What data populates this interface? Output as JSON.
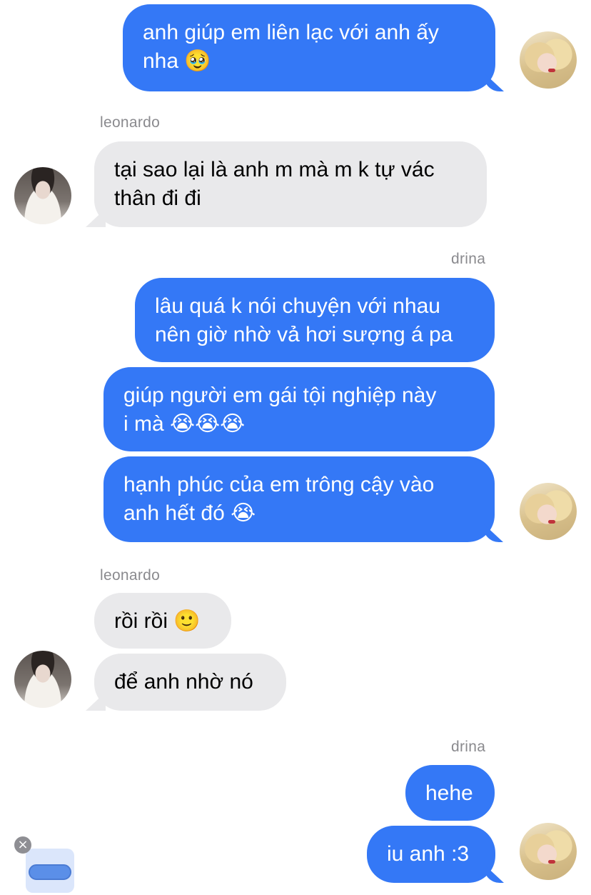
{
  "participants": {
    "other": "leonardo",
    "self": "drina"
  },
  "messages": [
    {
      "text": "anh giúp em liên lạc với anh ấy\nnha 🥹",
      "direction": "outgoing"
    },
    {
      "text": "tại sao lại là anh m mà m k tự vác\nthân đi đi",
      "direction": "incoming"
    },
    {
      "text": "lâu quá k nói chuyện với nhau\nnên giờ nhờ vả hơi sượng á pa",
      "direction": "outgoing"
    },
    {
      "text": "giúp người em gái tội nghiệp này\ni mà 😭😭😭",
      "direction": "outgoing"
    },
    {
      "text": "hạnh phúc của em trông cậy vào\nanh hết đó 😭",
      "direction": "outgoing"
    },
    {
      "text": "rồi rồi 🙂",
      "direction": "incoming"
    },
    {
      "text": "để anh nhờ nó",
      "direction": "incoming"
    },
    {
      "text": "hehe",
      "direction": "outgoing"
    },
    {
      "text": "iu anh :3",
      "direction": "outgoing"
    }
  ],
  "colors": {
    "outgoing_bubble": "#3478f6",
    "incoming_bubble": "#e9e9eb",
    "sender_label": "#8a8a8e"
  },
  "icons": {
    "dismiss": "×"
  }
}
